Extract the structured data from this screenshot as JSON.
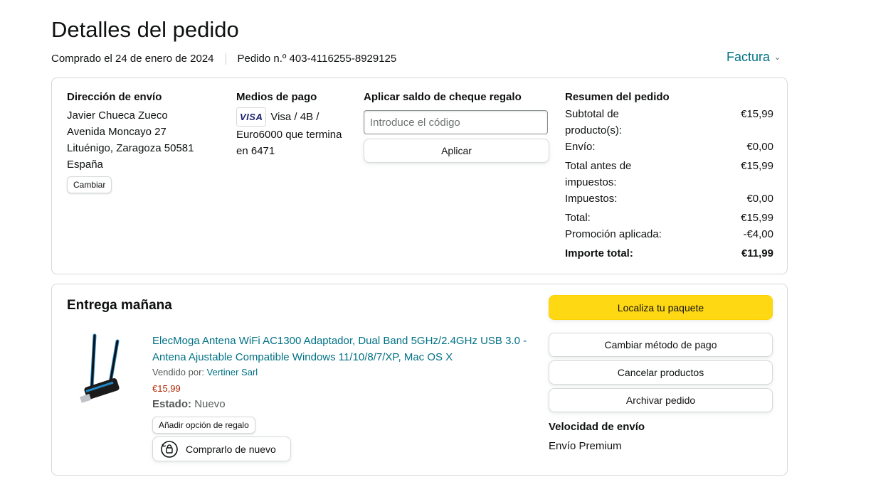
{
  "page": {
    "title": "Detalles del pedido",
    "purchased": "Comprado el 24 de enero de 2024",
    "order_number": "Pedido n.º 403-4116255-8929125",
    "invoice_label": "Factura"
  },
  "shipping": {
    "heading": "Dirección de envío",
    "lines": [
      "Javier Chueca Zueco",
      "Avenida Moncayo 27",
      "Lituénigo, Zaragoza 50581",
      "España"
    ],
    "change_label": "Cambiar"
  },
  "payment": {
    "heading": "Medios de pago",
    "card_brand": "VISA",
    "text_line1": "Visa / 4B /",
    "text_line2": "Euro6000 que termina",
    "text_line3": "en 6471"
  },
  "gift": {
    "heading": "Aplicar saldo de cheque regalo",
    "placeholder": "Introduce el código",
    "apply_label": "Aplicar"
  },
  "summary": {
    "heading": "Resumen del pedido",
    "rows": [
      {
        "label": "Subtotal de producto(s):",
        "value": "€15,99"
      },
      {
        "label": "Envío:",
        "value": "€0,00"
      },
      {
        "label": "Total antes de impuestos:",
        "value": "€15,99"
      },
      {
        "label": "Impuestos:",
        "value": "€0,00"
      },
      {
        "label": "Total:",
        "value": "€15,99"
      },
      {
        "label": "Promoción aplicada:",
        "value": "-€4,00"
      }
    ],
    "grand_label": "Importe total:",
    "grand_value": "€11,99"
  },
  "delivery": {
    "title": "Entrega mañana",
    "product_title": "ElecMoga Antena WiFi AC1300 Adaptador, Dual Band 5GHz/2.4GHz USB 3.0 - Antena Ajustable Compatible Windows 11/10/8/7/XP, Mac OS X",
    "sold_by_label": "Vendido por:",
    "seller": "Vertiner Sarl",
    "price": "€15,99",
    "state_label": "Estado:",
    "state_value": "Nuevo",
    "gift_option_label": "Añadir opción de regalo",
    "buy_again_label": "Comprarlo de nuevo"
  },
  "actions": {
    "track": "Localiza tu paquete",
    "change_payment": "Cambiar método de pago",
    "cancel": "Cancelar productos",
    "archive": "Archivar pedido"
  },
  "shipping_speed": {
    "heading": "Velocidad de envío",
    "value": "Envío Premium"
  },
  "colors": {
    "link": "#007185",
    "price": "#b12704",
    "primary_button": "#ffd814",
    "border": "#d5d9d9"
  }
}
